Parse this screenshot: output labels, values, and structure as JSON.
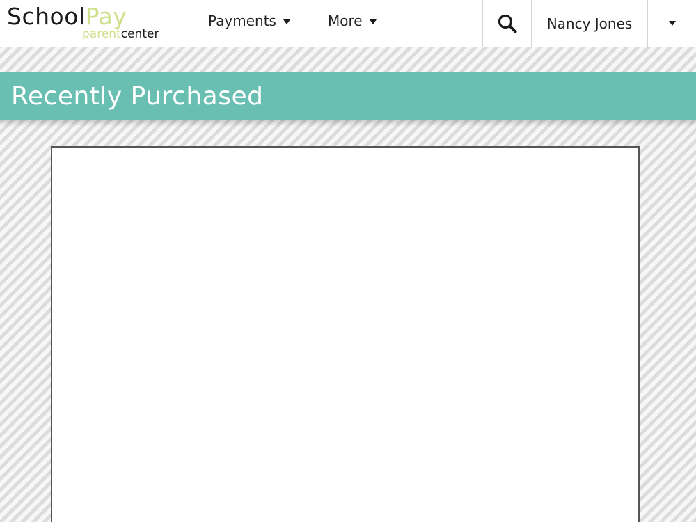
{
  "header": {
    "logo": {
      "school": "School",
      "pay": "Pay",
      "parent": "parent",
      "center": "center"
    },
    "nav": [
      {
        "label": "Payments"
      },
      {
        "label": "More"
      }
    ],
    "search_icon": "search-icon",
    "user": {
      "name": "Nancy Jones"
    }
  },
  "banner": {
    "title": "Recently Purchased",
    "color": "#6abfb3"
  },
  "colors": {
    "brand_accent": "#cfe08a",
    "banner": "#6abfb3"
  }
}
